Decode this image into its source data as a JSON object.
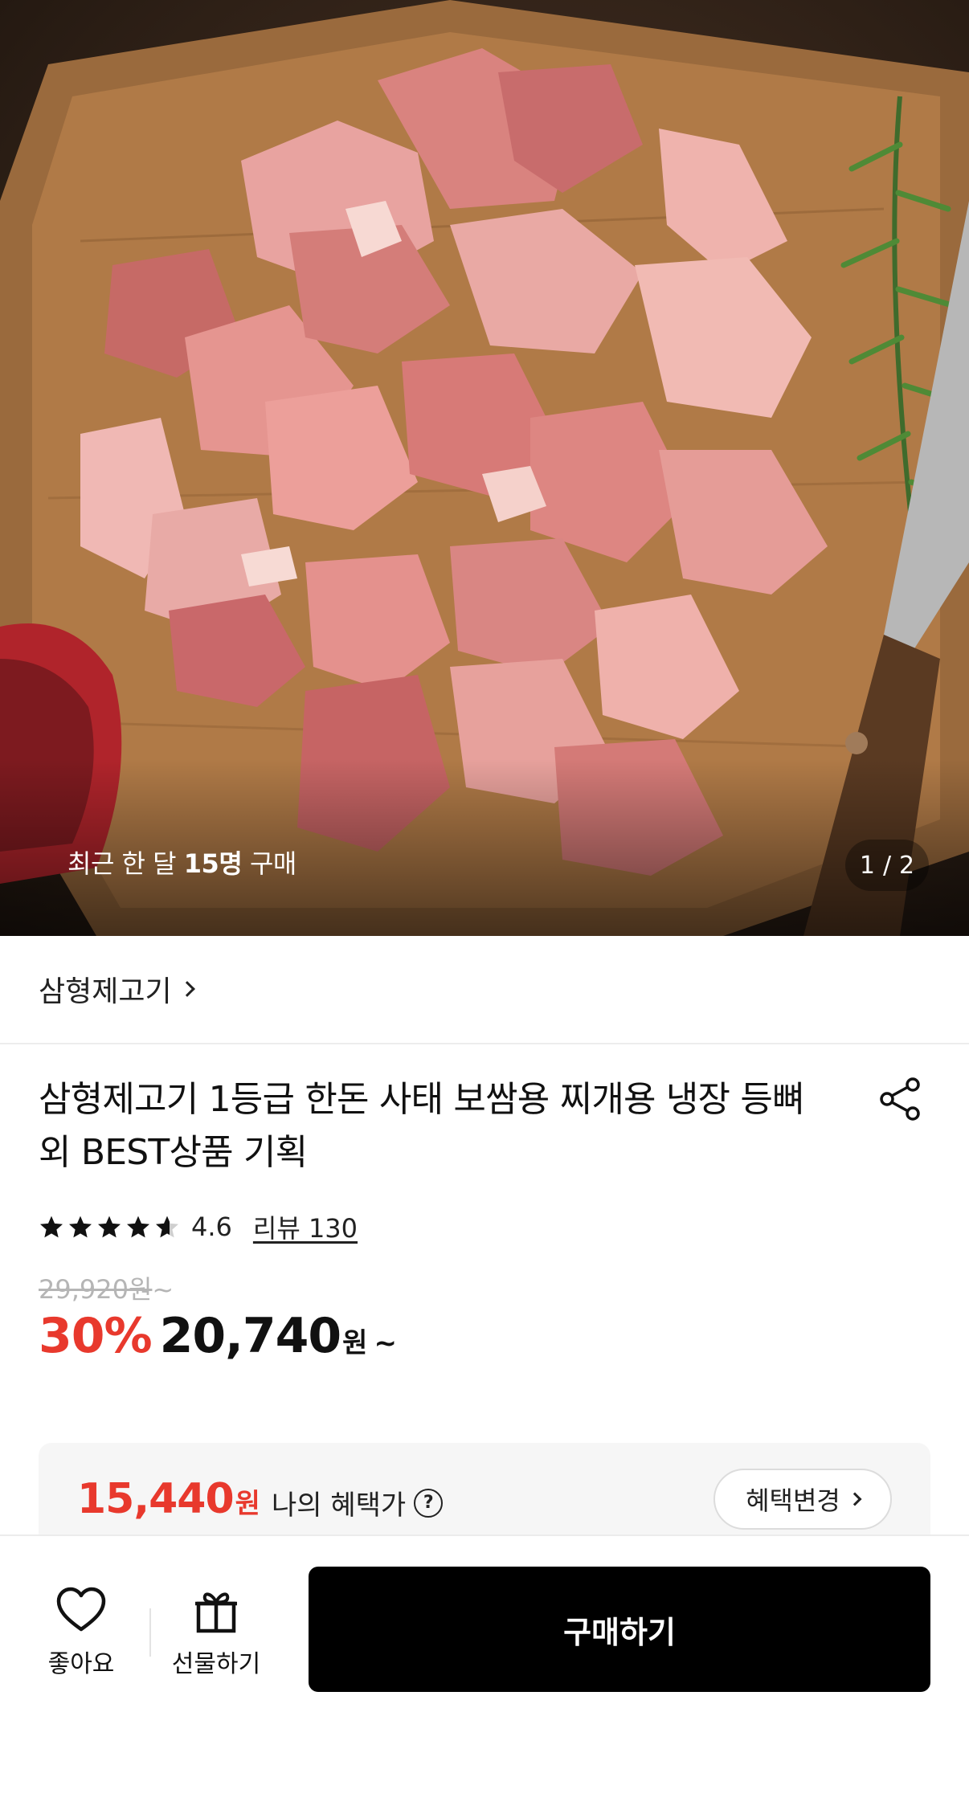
{
  "hero": {
    "image_alt": "",
    "recent_prefix": "최근 한 달 ",
    "recent_count": "15명",
    "recent_suffix": " 구매",
    "page_current": "1",
    "page_sep": "/",
    "page_total": "2"
  },
  "brand": {
    "name": "삼형제고기"
  },
  "product": {
    "title": "삼형제고기 1등급 한돈 사태 보쌈용 찌개용 냉장 등뼈 외 BEST상품 기획",
    "rating": "4.6",
    "rating_value": 4.6,
    "review_label": "리뷰 130",
    "original_price": "29,920원",
    "original_suffix": "~",
    "discount": "30%",
    "sale_price": "20,740",
    "won": "원",
    "tilde": "~"
  },
  "benefit": {
    "price": "15,440",
    "unit": "원",
    "label": "나의 혜택가",
    "help": "?",
    "change_label": "혜택변경"
  },
  "bottom_bar": {
    "like_label": "좋아요",
    "gift_label": "선물하기",
    "buy_label": "구매하기"
  },
  "colors": {
    "accent_red": "#e8392d",
    "buy_button": "#000000",
    "muted": "#b5b5b5"
  }
}
